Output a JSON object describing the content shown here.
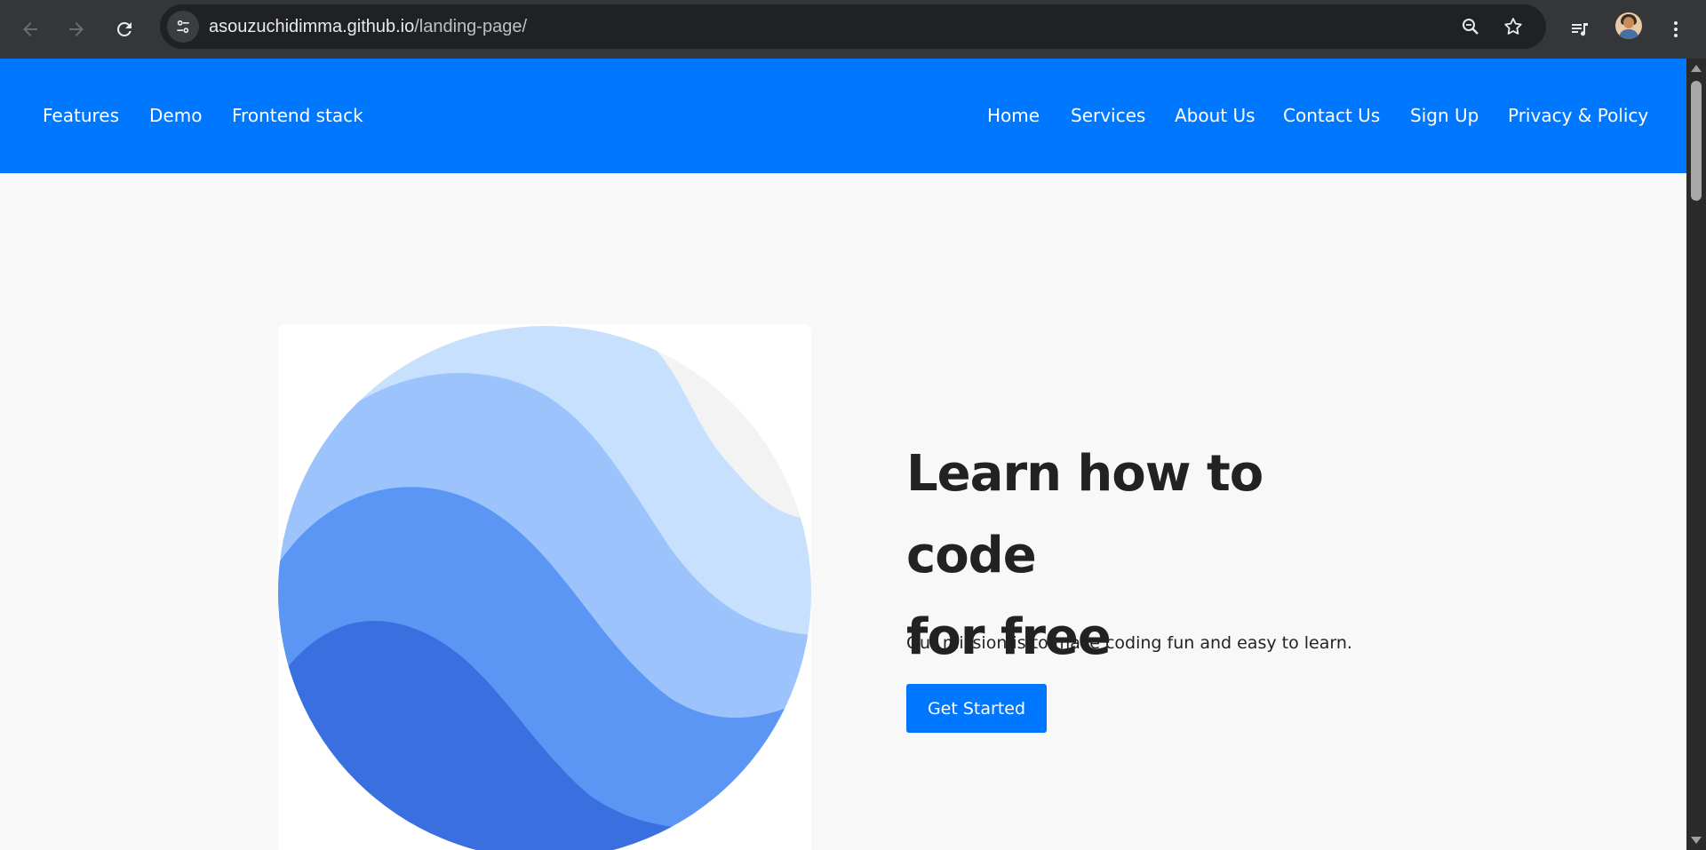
{
  "browser": {
    "url_host": "asouzuchidimma.github.io",
    "url_path": "/landing-page/",
    "icons": {
      "back": "arrow-left-icon",
      "forward": "arrow-right-icon",
      "reload": "reload-icon",
      "site_info": "tune-icon",
      "zoom": "zoom-icon",
      "bookmark": "star-icon",
      "media": "media-queue-icon",
      "profile": "avatar",
      "menu": "kebab-menu-icon"
    }
  },
  "header": {
    "left_links": [
      {
        "label": "Features"
      },
      {
        "label": "Demo"
      },
      {
        "label": "Frontend stack"
      }
    ],
    "right_links": [
      {
        "label": "Home"
      },
      {
        "label": "Services"
      },
      {
        "label": "About Us"
      },
      {
        "label": "Contact Us"
      },
      {
        "label": "Sign Up"
      },
      {
        "label": "Privacy & Policy"
      }
    ]
  },
  "hero": {
    "title_line1": "Learn how to code",
    "title_line2": "for free",
    "subtitle": "Our mission is to make coding fun and easy to learn.",
    "cta_label": "Get Started",
    "image_icon": "globe-waves-logo"
  },
  "colors": {
    "accent": "#0077ff",
    "page_bg": "#f8f8f8",
    "chrome_bg": "#35363a",
    "text": "#222222"
  }
}
